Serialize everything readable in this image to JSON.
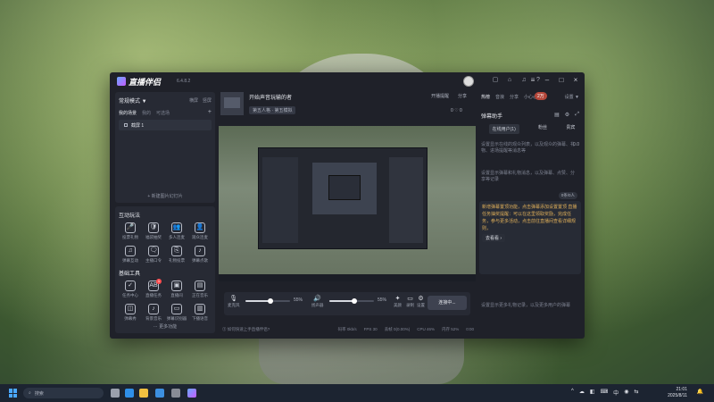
{
  "app": {
    "brand": "直播伴侣",
    "version": "6.4.8.2"
  },
  "left": {
    "mode_label": "常规模式 ▼",
    "mode_links": [
      "横屏",
      "竖屏"
    ],
    "scene_tabs": [
      "我的场景",
      "我的",
      "可选场"
    ],
    "scene_item": "截屏 1",
    "add_scene": "+ 新建图片幻灯片",
    "interact_title": "互动玩法",
    "interact_tools": [
      {
        "label": "投票礼物",
        "icon": "🎤"
      },
      {
        "label": "福袋抽奖",
        "icon": "🛡"
      },
      {
        "label": "多人连麦",
        "icon": "👥"
      },
      {
        "label": "观众连麦",
        "icon": "👤"
      },
      {
        "label": "弹幕互动",
        "icon": "♫"
      },
      {
        "label": "主播口令",
        "icon": "🗨"
      },
      {
        "label": "礼物投票",
        "icon": "⎘"
      },
      {
        "label": "弹幕点歌",
        "icon": "♪"
      }
    ],
    "basic_title": "基础工具",
    "basic_tools": [
      {
        "label": "任务中心",
        "icon": "✓",
        "badge": ""
      },
      {
        "label": "直播任务",
        "icon": "AB",
        "badge": "1"
      },
      {
        "label": "直播间",
        "icon": "▣",
        "badge": ""
      },
      {
        "label": "正在音乐",
        "icon": "▤",
        "badge": ""
      },
      {
        "label": "弹幕秀",
        "icon": "◫",
        "badge": ""
      },
      {
        "label": "背景音乐",
        "icon": "♪",
        "badge": ""
      },
      {
        "label": "弹幕识别器",
        "icon": "▭",
        "badge": ""
      },
      {
        "label": "下播语音",
        "icon": "▥",
        "badge": ""
      }
    ],
    "more_link": "⋯ 更多功能"
  },
  "center": {
    "live_title": "开始声音玩输的者",
    "category": "第五人格 · 第五模拟",
    "notice": "开播提醒",
    "share": "分享",
    "stats": "0  ♡ 0",
    "controls": {
      "mic_label": "麦克风",
      "mic_pct": "55%",
      "mic_level": 0.55,
      "speaker_label": "扬声器",
      "speaker_pct": "55%",
      "speaker_level": 0.55,
      "beauty_label": "美颜",
      "record_label": "录制",
      "settings_label": "设置",
      "live_btn": "连接中..."
    },
    "status_hint": "⓵ 如何快速上手直播伴侣?",
    "status_items": [
      "码率 0kb/s",
      "FPS 30",
      "丢帧 0(0.00%)",
      "CPU 46%",
      "内存 52%",
      "0:00"
    ]
  },
  "right": {
    "tabs": [
      "热榜",
      "音浪",
      "分享",
      "小心心"
    ],
    "sub_count": "2万",
    "settings": "设置 ▼",
    "danmu_title": "弹幕助手",
    "sub_tabs": [
      "在线用户(1)",
      "粉丝",
      "贵宾"
    ],
    "hint_top": "设置显示在线的观众列表，以及观众的弹幕、礼物、进场提醒等消息等",
    "count": "0.0",
    "hint_mid": "设置显示弹幕和礼物消息，以及弹幕、点赞、分享等记录",
    "notice_page": "0条/0人",
    "notice_text": "新增弹幕置顶功能，点击弹幕添加设置置顶 直播任务抽奖提醒：可以在这里领取奖励，完成任务，参与更多活动，点击前往直播间查看详细规则，",
    "notice_btn": "去看看 ›",
    "notice_hint": "",
    "input_hint": "设置显示更多礼物记录，以及更多用户的弹幕"
  },
  "taskbar": {
    "search": "搜索",
    "time": "21:01",
    "date": "2025/8/11",
    "tray": [
      "^",
      "☁",
      "◧",
      "⌨",
      "中",
      "◉",
      "⇆",
      "🔔"
    ]
  },
  "colors": {
    "accent": "#b5473a",
    "notice": "#e2b15a"
  }
}
